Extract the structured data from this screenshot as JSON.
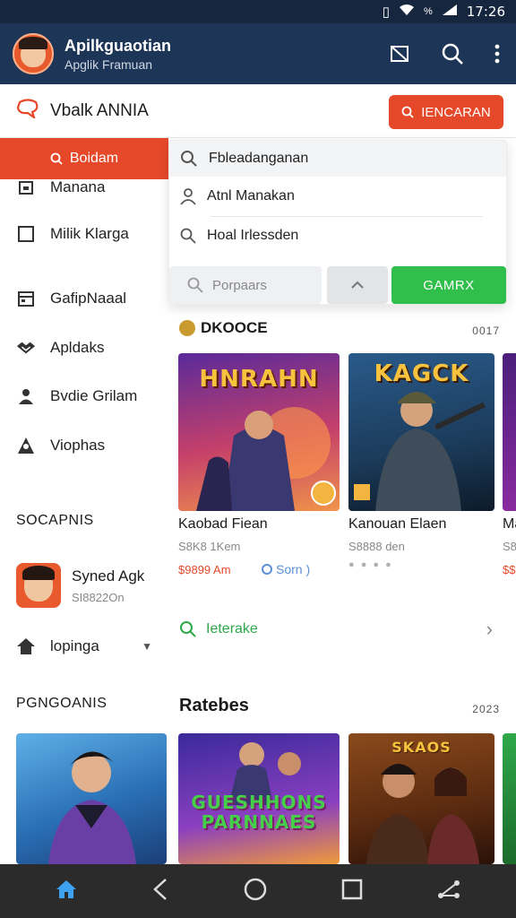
{
  "status_bar": {
    "time": "17:26"
  },
  "app_bar": {
    "title": "Apilkguaotian",
    "subtitle": "Apglik Framuan"
  },
  "subheader": {
    "title": "Vbalk ANNIA",
    "search_button": "IENCARAN"
  },
  "sidebar": {
    "active_item": "Boidam",
    "items": [
      {
        "label": "Manana",
        "icon": "calendar-icon"
      },
      {
        "label": "Milik Klarga",
        "icon": "checkbox-icon"
      },
      {
        "label": "GafipNaaal",
        "icon": "calendar-grid-icon"
      },
      {
        "label": "Apldaks",
        "icon": "handshake-icon"
      },
      {
        "label": "Bvdie Grilam",
        "icon": "person-icon"
      },
      {
        "label": "Viophas",
        "icon": "person-tree-icon"
      }
    ],
    "section1": "SOCAPNIS",
    "user": {
      "name": "Syned Agk",
      "sub": "SI8822On"
    },
    "more": "lopinga",
    "section2": "PGNGOANIS"
  },
  "dropdown": {
    "rows": [
      {
        "label": "Fbleadanganan",
        "icon": "search-icon"
      },
      {
        "label": "Atnl Manakan",
        "icon": "person-icon"
      },
      {
        "label": "Hoal Irlessden",
        "icon": "search-icon"
      }
    ],
    "input_placeholder": "Porpaars",
    "middle_icon": "chevron-up-icon",
    "go_button": "GAMRX"
  },
  "main": {
    "section1": {
      "title": "DKOOCE",
      "count": "0017"
    },
    "cards": [
      {
        "art_title": "HNRAHN",
        "name": "Kaobad Fiean",
        "sub": "S8K8 1Kem",
        "price": "$9899 Am",
        "accent": "#7a3fb0"
      },
      {
        "art_title": "KAGCK",
        "name": "Kanouan Elaen",
        "sub": "S8888 den",
        "rating": "Sorn )",
        "accent": "#1c4a72"
      },
      {
        "art_title": "",
        "name": "Ma",
        "sub": "S8",
        "price": "$$",
        "accent": "#6a2a8a"
      }
    ],
    "link": "Ieterake",
    "section2": {
      "title": "Ratebes",
      "count": "2023"
    },
    "cards2": [
      {
        "art_title": "GUESHHONS PARNNAES",
        "accent": "#5a2fb0"
      },
      {
        "art_title": "SKAOS",
        "accent": "#8a4a1c"
      }
    ]
  },
  "nav": [
    "home-icon",
    "back-icon",
    "circle-home-icon",
    "square-recents-icon",
    "share-icon"
  ]
}
